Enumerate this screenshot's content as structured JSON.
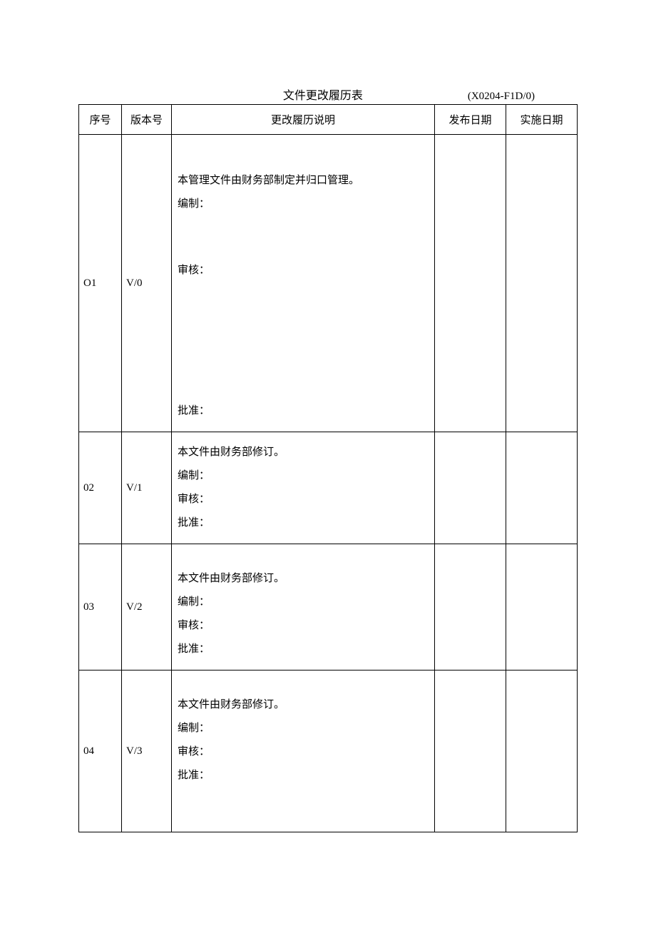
{
  "header": {
    "title": "文件更改履历表",
    "doc_code": "(X0204-F1D/0)"
  },
  "columns": {
    "seq": "序号",
    "ver": "版本号",
    "desc": "更改履历说明",
    "pub": "发布日期",
    "imp": "实施日期"
  },
  "rows": [
    {
      "seq": "O1",
      "ver": "V/0",
      "desc_lines": {
        "intro": "本管理文件由财务部制定并归口管理。",
        "compile": "编制：",
        "review": "审核：",
        "approve": "批准："
      },
      "pub": "",
      "imp": ""
    },
    {
      "seq": "02",
      "ver": "V/1",
      "desc_lines": {
        "intro": "本文件由财务部修订。",
        "compile": "编制：",
        "review": "审核：",
        "approve": "批准："
      },
      "pub": "",
      "imp": ""
    },
    {
      "seq": "03",
      "ver": "V/2",
      "desc_lines": {
        "intro": "本文件由财务部修订。",
        "compile": "编制：",
        "review": "审核：",
        "approve": "批准："
      },
      "pub": "",
      "imp": ""
    },
    {
      "seq": "04",
      "ver": "V/3",
      "desc_lines": {
        "intro": "本文件由财务部修订。",
        "compile": "编制：",
        "review": "审核：",
        "approve": "批准："
      },
      "pub": "",
      "imp": ""
    }
  ]
}
